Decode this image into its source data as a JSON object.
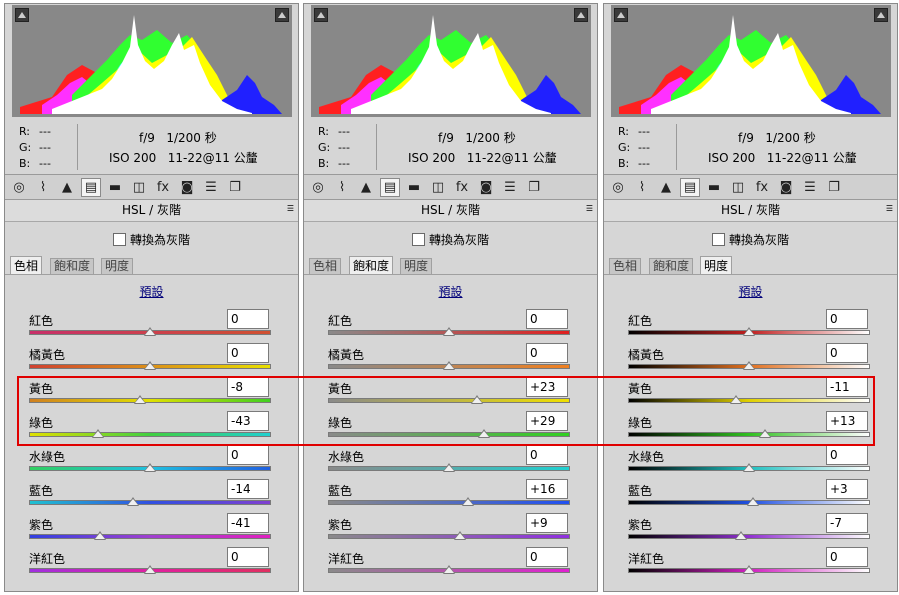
{
  "colors": {
    "highlight": "#e00000",
    "panel_bg": "#d6d6d6",
    "histogram_bg": "#888888"
  },
  "panels": [
    {
      "rgb": {
        "r_label": "R:",
        "g_label": "G:",
        "b_label": "B:",
        "r": "---",
        "g": "---",
        "b": "---"
      },
      "exif": {
        "aperture": "f/9",
        "shutter": "1/200 秒",
        "iso": "ISO 200",
        "lens": "11-22@11 公釐"
      },
      "panel_title": "HSL / 灰階",
      "grayscale_label": "轉換為灰階",
      "tabs": [
        "色相",
        "飽和度",
        "明度"
      ],
      "active_tab": 0,
      "preset_label": "預設",
      "slider_mode": "hue",
      "sliders": [
        {
          "label": "紅色",
          "value": "0"
        },
        {
          "label": "橘黃色",
          "value": "0"
        },
        {
          "label": "黃色",
          "value": "-8"
        },
        {
          "label": "綠色",
          "value": "-43"
        },
        {
          "label": "水綠色",
          "value": "0"
        },
        {
          "label": "藍色",
          "value": "-14"
        },
        {
          "label": "紫色",
          "value": "-41"
        },
        {
          "label": "洋紅色",
          "value": "0"
        }
      ]
    },
    {
      "rgb": {
        "r_label": "R:",
        "g_label": "G:",
        "b_label": "B:",
        "r": "---",
        "g": "---",
        "b": "---"
      },
      "exif": {
        "aperture": "f/9",
        "shutter": "1/200 秒",
        "iso": "ISO 200",
        "lens": "11-22@11 公釐"
      },
      "panel_title": "HSL / 灰階",
      "grayscale_label": "轉換為灰階",
      "tabs": [
        "色相",
        "飽和度",
        "明度"
      ],
      "active_tab": 1,
      "preset_label": "預設",
      "slider_mode": "saturation",
      "sliders": [
        {
          "label": "紅色",
          "value": "0"
        },
        {
          "label": "橘黃色",
          "value": "0"
        },
        {
          "label": "黃色",
          "value": "+23"
        },
        {
          "label": "綠色",
          "value": "+29"
        },
        {
          "label": "水綠色",
          "value": "0"
        },
        {
          "label": "藍色",
          "value": "+16"
        },
        {
          "label": "紫色",
          "value": "+9"
        },
        {
          "label": "洋紅色",
          "value": "0"
        }
      ]
    },
    {
      "rgb": {
        "r_label": "R:",
        "g_label": "G:",
        "b_label": "B:",
        "r": "---",
        "g": "---",
        "b": "---"
      },
      "exif": {
        "aperture": "f/9",
        "shutter": "1/200 秒",
        "iso": "ISO 200",
        "lens": "11-22@11 公釐"
      },
      "panel_title": "HSL / 灰階",
      "grayscale_label": "轉換為灰階",
      "tabs": [
        "色相",
        "飽和度",
        "明度"
      ],
      "active_tab": 2,
      "preset_label": "預設",
      "slider_mode": "luminance",
      "sliders": [
        {
          "label": "紅色",
          "value": "0"
        },
        {
          "label": "橘黃色",
          "value": "0"
        },
        {
          "label": "黃色",
          "value": "-11"
        },
        {
          "label": "綠色",
          "value": "+13"
        },
        {
          "label": "水綠色",
          "value": "0"
        },
        {
          "label": "藍色",
          "value": "+3"
        },
        {
          "label": "紫色",
          "value": "-7"
        },
        {
          "label": "洋紅色",
          "value": "0"
        }
      ]
    }
  ],
  "toolbar_icons": [
    "aperture-icon",
    "tone-curve-icon",
    "detail-icon",
    "hsl-icon",
    "split-toning-icon",
    "lens-corrections-icon",
    "effects-icon",
    "camera-calibration-icon",
    "presets-icon",
    "snapshots-icon"
  ],
  "active_toolbar_index": 3
}
